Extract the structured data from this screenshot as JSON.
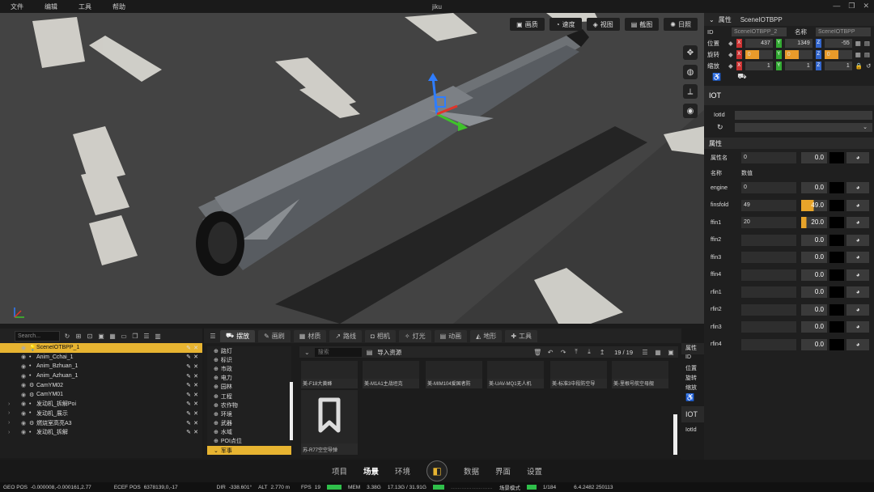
{
  "menu": [
    "文件",
    "编辑",
    "工具",
    "帮助"
  ],
  "window_title": "jiku",
  "viewport": {
    "buttons": [
      {
        "icon": "image-icon",
        "label": "画质"
      },
      {
        "icon": "speed-icon",
        "label": "速度"
      },
      {
        "icon": "view-icon",
        "label": "视图"
      },
      {
        "icon": "screenshot-icon",
        "label": "截图"
      },
      {
        "icon": "sun-icon",
        "label": "日照"
      }
    ],
    "side_tools": [
      "move-icon",
      "globe-icon",
      "axis-icon",
      "globe-settings-icon"
    ]
  },
  "outliner": {
    "search_placeholder": "Search...",
    "items": [
      {
        "label": "SceneIOTBPP_1",
        "selected": true
      },
      {
        "label": "Anim_Cchai_1"
      },
      {
        "label": "Anim_Bzhuan_1"
      },
      {
        "label": "Anim_Azhuan_1"
      },
      {
        "label": "CamYM02"
      },
      {
        "label": "CamYM01"
      },
      {
        "label": "发动机_拆解Poi"
      },
      {
        "label": "发动机_展示"
      },
      {
        "label": "燃烧室高亮A3"
      },
      {
        "label": "发动机_拆解"
      }
    ]
  },
  "content": {
    "tabs": [
      "摆放",
      "画刷",
      "材质",
      "路线",
      "相机",
      "灯光",
      "动画",
      "地形",
      "工具"
    ],
    "categories": [
      "路灯",
      "标识",
      "市政",
      "电力",
      "园林",
      "工程",
      "农作物",
      "环境",
      "武器",
      "水域",
      "POI点位",
      "军事"
    ],
    "search_placeholder": "搜索",
    "import_label": "导入资源",
    "page": "19 / 19",
    "assets": [
      "美-F18大黄蜂",
      "美-M1A1主战坦克",
      "美-MIM104爱国者防",
      "美-UAV-MQ1无人机",
      "美-标准3中段防空导",
      "美-里根号航空母舰",
      "苏-R77空空导弹"
    ]
  },
  "bottom_nav": [
    "项目",
    "场景",
    "环境",
    "数据",
    "界面",
    "设置"
  ],
  "status": {
    "geo_label": "GEO POS",
    "geo": "-0.000008,-0.000161,2.77",
    "ecef_label": "ECEF POS",
    "ecef": "6378139,0,-17",
    "dir_label": "DIR",
    "dir": "-338.601°",
    "alt_label": "ALT",
    "alt": "2.770 m",
    "fps_label": "FPS",
    "fps": "19",
    "mem_label": "MEM",
    "mem": "3.38G",
    "mem2": "17.13G / 31.91G",
    "mode_label": "场景模式",
    "count": "1/184",
    "version": "6.4.2482 250113"
  },
  "props": {
    "header": "属性",
    "object": "SceneIOTBPP",
    "id_label": "ID",
    "id_value": "SceneIOTBPP_2",
    "name_label": "名称",
    "name_value": "SceneIOTBPP",
    "pos_label": "位置",
    "rot_label": "旋转",
    "scale_label": "缩放",
    "pos": [
      "437",
      "1349",
      "-55"
    ],
    "rot": [
      "0",
      "0",
      "0"
    ],
    "scale": [
      "1",
      "1",
      "1"
    ],
    "iot_title": "IOT",
    "iotid_label": "IotId",
    "attr_section": "属性",
    "attr_name_label": "属性名",
    "attr_name_value": "0",
    "attr_num": "0.0",
    "col_name": "名称",
    "col_value": "数值",
    "rows": [
      {
        "name": "engine",
        "val": "0",
        "num": "0.0",
        "fill": 0
      },
      {
        "name": "finsfold",
        "val": "49",
        "num": "49.0",
        "fill": 0.49
      },
      {
        "name": "ffin1",
        "val": "20",
        "num": "20.0",
        "fill": 0.2
      },
      {
        "name": "ffin2",
        "val": "",
        "num": "0.0",
        "fill": 0
      },
      {
        "name": "ffin3",
        "val": "",
        "num": "0.0",
        "fill": 0
      },
      {
        "name": "ffin4",
        "val": "",
        "num": "0.0",
        "fill": 0
      },
      {
        "name": "rfin1",
        "val": "",
        "num": "0.0",
        "fill": 0
      },
      {
        "name": "rfin2",
        "val": "",
        "num": "0.0",
        "fill": 0
      },
      {
        "name": "rfin3",
        "val": "",
        "num": "0.0",
        "fill": 0
      },
      {
        "name": "rfin4",
        "val": "",
        "num": "0.0",
        "fill": 0
      }
    ]
  },
  "dock": {
    "header": "属性",
    "items": [
      "ID",
      "位置",
      "旋转",
      "缩放"
    ],
    "iot": "IOT",
    "iotid": "IotId"
  }
}
